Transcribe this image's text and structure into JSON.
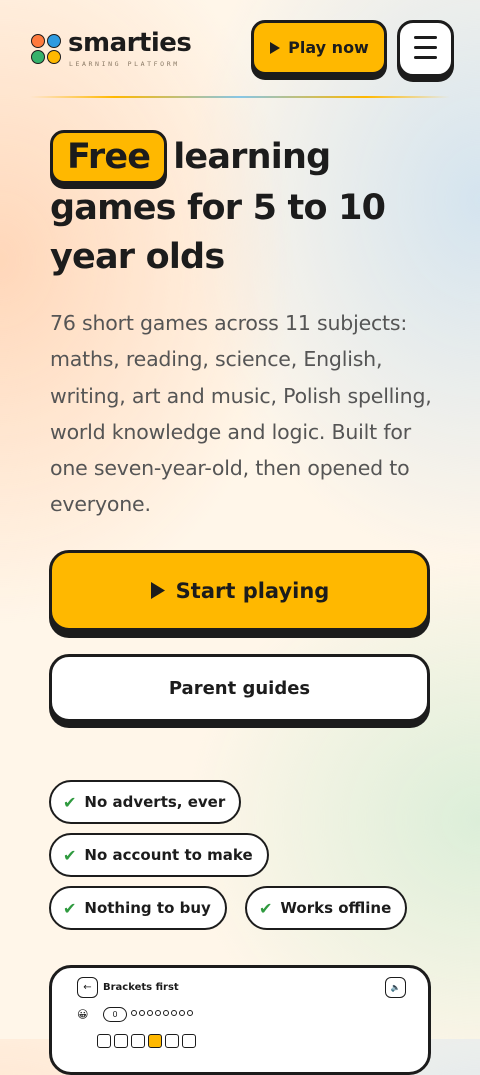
{
  "header": {
    "logo_title": "smarties",
    "logo_subtitle": "LEARNING PLATFORM",
    "logo_colors": [
      "#ff7a3d",
      "#2f9be0",
      "#36b26b",
      "#ffb800"
    ],
    "play_now_label": "Play now",
    "menu_icon": "hamburger-menu-icon"
  },
  "hero": {
    "badge": "Free",
    "title_line1_rest": "learning",
    "title_line2": "games for 5 to 10",
    "title_line3": "year olds",
    "description": "76 short games across 11 subjects: maths, reading, science, English, writing, art and music, Polish spelling, world knowledge and logic. Built for one seven-year-old, then opened to everyone."
  },
  "actions": {
    "start_label": "Start playing",
    "parent_label": "Parent guides"
  },
  "features": [
    "No adverts, ever",
    "No account to make",
    "Nothing to buy",
    "Works offline"
  ],
  "preview": {
    "title": "Brackets first",
    "score": "0"
  },
  "colors": {
    "accent": "#ffb800",
    "ink": "#1c1c1c",
    "check": "#2f9a3f"
  }
}
